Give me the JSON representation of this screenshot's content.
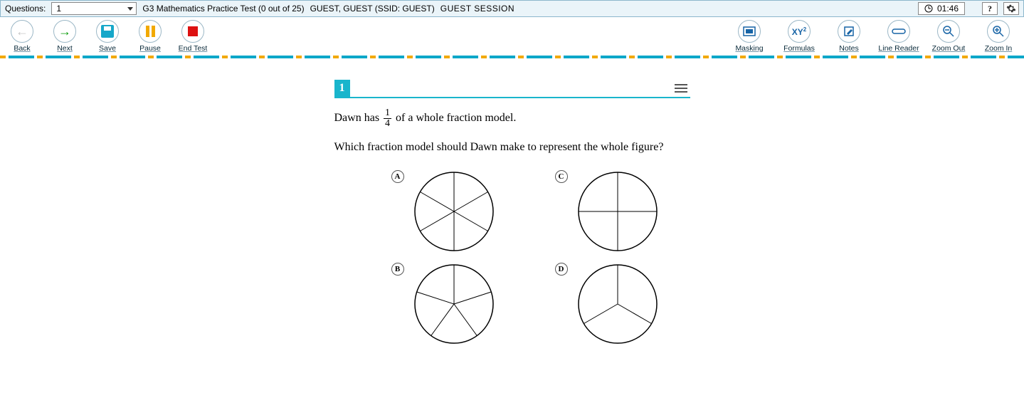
{
  "header": {
    "questions_label": "Questions:",
    "current_question": "1",
    "test_title": "G3 Mathematics Practice Test (0 out of 25)",
    "user_info": "GUEST, GUEST (SSID: GUEST)",
    "session": "GUEST SESSION",
    "timer": "01:46",
    "help": "?"
  },
  "toolbar": {
    "back": "Back",
    "next": "Next",
    "save": "Save",
    "pause": "Pause",
    "end": "End Test",
    "masking": "Masking",
    "formulas": "Formulas",
    "formulas_icon": "XY",
    "notes": "Notes",
    "line_reader": "Line Reader",
    "zoom_out": "Zoom Out",
    "zoom_in": "Zoom In"
  },
  "question": {
    "number": "1",
    "stem_pre": "Dawn has ",
    "frac_num": "1",
    "frac_den": "4",
    "stem_post": " of a whole fraction model.",
    "prompt": "Which fraction model should Dawn make to represent the whole figure?",
    "choices": {
      "a": "A",
      "b": "B",
      "c": "C",
      "d": "D"
    }
  }
}
